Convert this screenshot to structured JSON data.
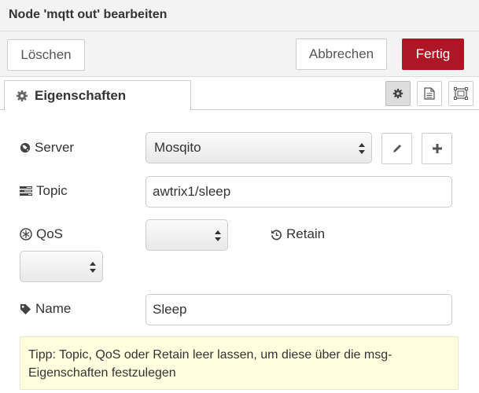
{
  "dialog": {
    "title": "Node 'mqtt out' bearbeiten"
  },
  "buttons": {
    "delete": "Löschen",
    "cancel": "Abbrechen",
    "done": "Fertig"
  },
  "tabs": {
    "properties": "Eigenschaften"
  },
  "tab_buttons": [
    {
      "icon": "gear-icon"
    },
    {
      "icon": "document-icon"
    },
    {
      "icon": "layout-icon"
    }
  ],
  "fields": {
    "server": {
      "label": "Server",
      "value": "Mosqito",
      "icon": "globe-icon"
    },
    "topic": {
      "label": "Topic",
      "value": "awtrix1/sleep",
      "icon": "tasks-icon"
    },
    "qos": {
      "label": "QoS",
      "value": "",
      "icon": "snowflake-icon"
    },
    "retain": {
      "label": "Retain",
      "value": "",
      "icon": "history-icon"
    },
    "name": {
      "label": "Name",
      "value": "Sleep",
      "icon": "tag-icon"
    }
  },
  "tip": "Tipp: Topic, QoS oder Retain leer lassen, um diese über die msg-Eigenschaften festzulegen",
  "colors": {
    "primary": "#ad1625",
    "tip_bg": "#ffffe0"
  }
}
